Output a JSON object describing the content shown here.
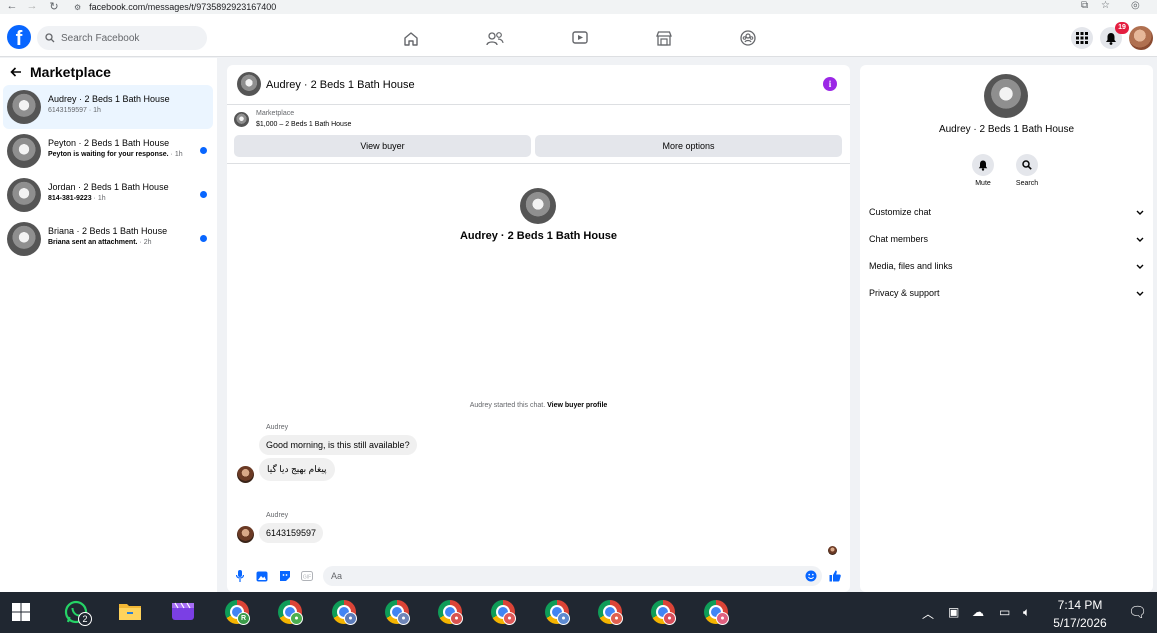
{
  "browser": {
    "url": "facebook.com/messages/t/9735892923167400",
    "back_icon": "arrow-left-icon",
    "forward_icon": "arrow-right-icon",
    "reload_icon": "reload-icon"
  },
  "header": {
    "logo": "f",
    "search_placeholder": "Search Facebook",
    "notification_count": "19"
  },
  "left": {
    "title": "Marketplace",
    "conversations": [
      {
        "name": "Audrey · 2 Beds 1 Bath House",
        "preview": "6143159597",
        "time": " · 1h",
        "unread": false,
        "active": true
      },
      {
        "name": "Peyton · 2 Beds 1 Bath House",
        "preview": "Peyton is waiting for your response.",
        "time": " · 1h",
        "unread": true,
        "active": false
      },
      {
        "name": "Jordan · 2 Beds 1 Bath House",
        "preview": "814-381-9223",
        "time": " · 1h",
        "unread": true,
        "active": false
      },
      {
        "name": "Briana · 2 Beds 1 Bath House",
        "preview": "Briana sent an attachment.",
        "time": " · 2h",
        "unread": true,
        "active": false
      }
    ]
  },
  "chat": {
    "title": "Audrey · 2 Beds 1 Bath House",
    "marketplace_label": "Marketplace",
    "listing": "$1,000 – 2 Beds 1 Bath House",
    "view_buyer": "View buyer",
    "more_options": "More options",
    "center_name": "Audrey · 2 Beds 1 Bath House",
    "started_text": "Audrey started this chat.",
    "view_buyer_profile": "View buyer profile",
    "messages": [
      {
        "sender": "Audrey",
        "text": "Good morning, is this still available?"
      },
      {
        "sender": "",
        "text": "پیغام بھیج دیا گیا"
      },
      {
        "sender": "Audrey",
        "text": "6143159597"
      }
    ],
    "input_placeholder": "Aa"
  },
  "right": {
    "name": "Audrey · 2 Beds 1 Bath House",
    "mute": "Mute",
    "search": "Search",
    "sections": [
      "Customize chat",
      "Chat members",
      "Media, files and links",
      "Privacy & support"
    ]
  },
  "taskbar": {
    "whatsapp_count": "2",
    "time": "7:14 PM",
    "date": "5/17/2026",
    "chrome_profiles": [
      {
        "letter": "R",
        "color": "#3b9b4a"
      },
      {
        "letter": "",
        "color": "#4caf50"
      },
      {
        "letter": "",
        "color": "#5c7cba"
      },
      {
        "letter": "",
        "color": "#6f86b8"
      },
      {
        "letter": "",
        "color": "#d9534f"
      },
      {
        "letter": "",
        "color": "#e05a5a"
      },
      {
        "letter": "",
        "color": "#5d8ad0"
      },
      {
        "letter": "",
        "color": "#e0604f"
      },
      {
        "letter": "",
        "color": "#d94f5c"
      },
      {
        "letter": "",
        "color": "#e06080"
      }
    ]
  }
}
